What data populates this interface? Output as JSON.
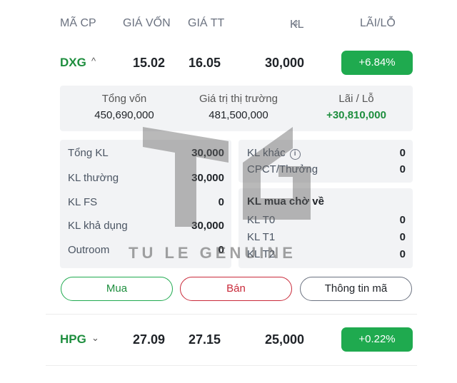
{
  "header": {
    "code": "MÃ CP",
    "cost_price": "GIÁ VỐN",
    "market_price": "GIÁ TT",
    "quantity": "KL",
    "sort_icon": "sort-icon",
    "profit_loss": "LÃI/LỖ"
  },
  "stocks": [
    {
      "code": "DXG",
      "expanded": true,
      "cost_price": "15.02",
      "market_price": "16.05",
      "quantity": "30,000",
      "pl_percent": "+6.84%",
      "summary": {
        "total_cost_label": "Tổng vốn",
        "total_cost": "450,690,000",
        "market_value_label": "Giá trị thị trường",
        "market_value": "481,500,000",
        "pl_label": "Lãi / Lỗ",
        "pl_value": "+30,810,000"
      },
      "details_left": [
        {
          "label": "Tổng KL",
          "value": "30,000"
        },
        {
          "label": "KL thường",
          "value": "30,000"
        },
        {
          "label": "KL FS",
          "value": "0"
        },
        {
          "label": "KL khả dụng",
          "value": "30,000"
        },
        {
          "label": "Outroom",
          "value": "0"
        }
      ],
      "details_right": [
        {
          "label": "KL khác",
          "value": "0"
        },
        {
          "label": "CPCT/Thưởng",
          "value": "0"
        }
      ],
      "pending": {
        "title": "KL mua chờ về",
        "rows": [
          {
            "label": "KL T0",
            "value": "0"
          },
          {
            "label": "KL T1",
            "value": "0"
          },
          {
            "label": "KL T2",
            "value": "0"
          }
        ]
      },
      "actions": {
        "buy": "Mua",
        "sell": "Bán",
        "info": "Thông tin mã"
      }
    },
    {
      "code": "HPG",
      "expanded": false,
      "cost_price": "27.09",
      "market_price": "27.15",
      "quantity": "25,000",
      "pl_percent": "+0.22%"
    }
  ],
  "watermark": {
    "text": "TU LE GENUINE"
  },
  "colors": {
    "green": "#1faa4f",
    "code_green": "#1e8e3e",
    "red": "#c92a3a",
    "panel_bg": "#f2f3f5"
  }
}
